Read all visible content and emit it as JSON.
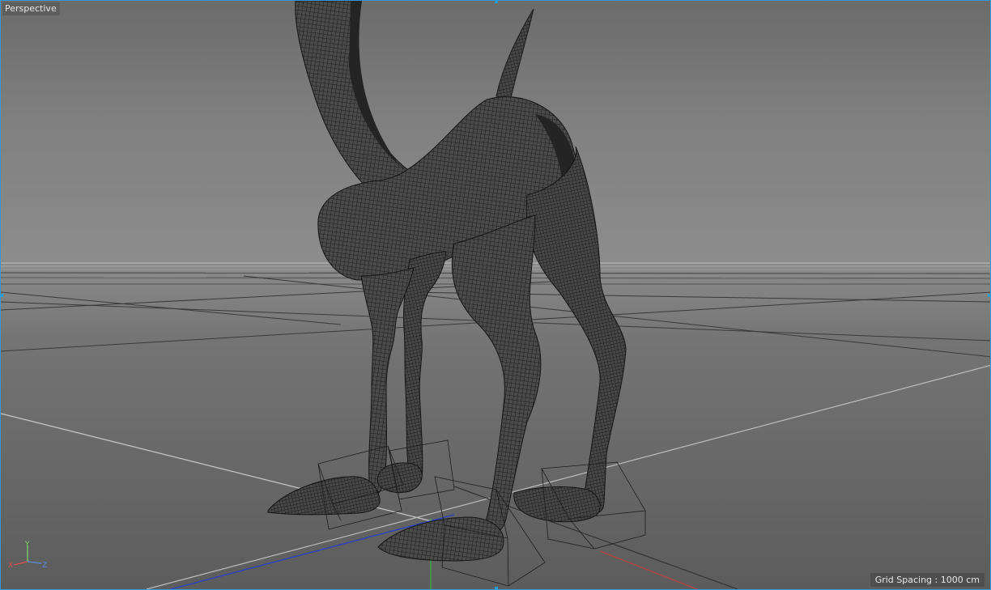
{
  "viewport": {
    "camera_label": "Perspective",
    "grid_spacing_text": "Grid Spacing : 1000 cm",
    "border_color": "#2f9ad8",
    "axis_gizmo": {
      "y_label": "Y",
      "x_label": "X",
      "z_label": "Z",
      "y_color": "#7fd66a",
      "x_color": "#e05050",
      "z_color": "#5a8ce8"
    }
  }
}
